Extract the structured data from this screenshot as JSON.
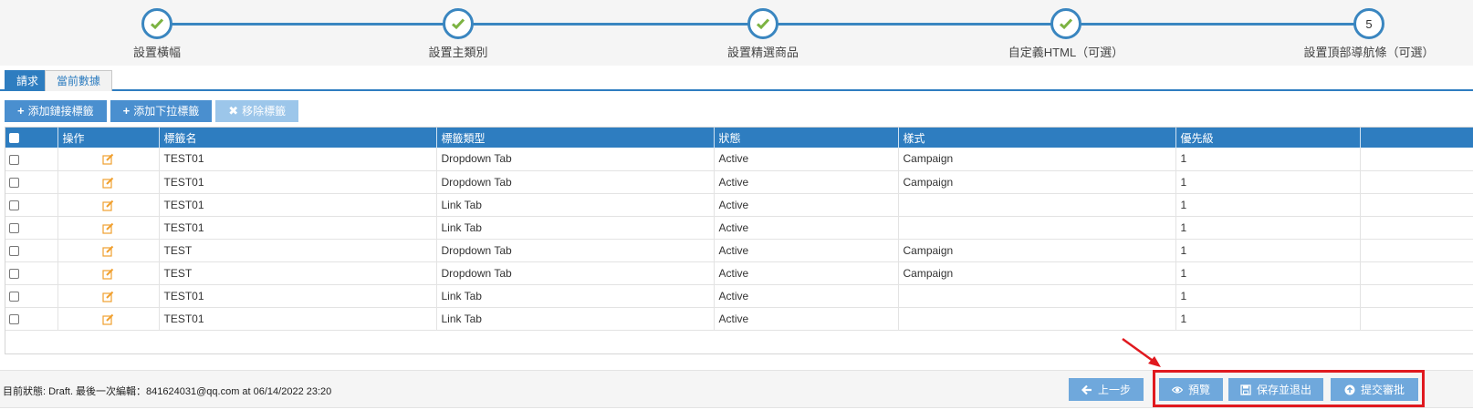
{
  "stepper": {
    "steps": [
      {
        "label": "設置橫幅",
        "done": true
      },
      {
        "label": "設置主類別",
        "done": true
      },
      {
        "label": "設置精選商品",
        "done": true
      },
      {
        "label": "自定義HTML（可選）",
        "done": true
      },
      {
        "label": "設置頂部導航條（可選）",
        "done": false,
        "number": "5"
      }
    ]
  },
  "tabs": [
    {
      "label": "請求",
      "active": true
    },
    {
      "label": "當前數據",
      "active": false
    }
  ],
  "toolbar": {
    "add_link_label": "添加鏈接標籤",
    "add_dropdown_label": "添加下拉標籤",
    "remove_label": "移除標籤"
  },
  "table": {
    "headers": [
      "",
      "操作",
      "標籤名",
      "標籤類型",
      "狀態",
      "樣式",
      "優先級",
      ""
    ],
    "rows": [
      {
        "name": "TEST01",
        "type": "Dropdown Tab",
        "status": "Active",
        "style": "Campaign",
        "priority": "1"
      },
      {
        "name": "TEST01",
        "type": "Dropdown Tab",
        "status": "Active",
        "style": "Campaign",
        "priority": "1"
      },
      {
        "name": "TEST01",
        "type": "Link Tab",
        "status": "Active",
        "style": "",
        "priority": "1"
      },
      {
        "name": "TEST01",
        "type": "Link Tab",
        "status": "Active",
        "style": "",
        "priority": "1"
      },
      {
        "name": "TEST",
        "type": "Dropdown Tab",
        "status": "Active",
        "style": "Campaign",
        "priority": "1"
      },
      {
        "name": "TEST",
        "type": "Dropdown Tab",
        "status": "Active",
        "style": "Campaign",
        "priority": "1"
      },
      {
        "name": "TEST01",
        "type": "Link Tab",
        "status": "Active",
        "style": "",
        "priority": "1"
      },
      {
        "name": "TEST01",
        "type": "Link Tab",
        "status": "Active",
        "style": "",
        "priority": "1"
      }
    ]
  },
  "footer": {
    "status_text": "目前狀態: Draft. 最後一次編輯：841624031@qq.com at 06/14/2022 23:20",
    "prev_label": "上一步",
    "preview_label": "預覽",
    "save_exit_label": "保存並退出",
    "submit_label": "提交審批"
  },
  "colors": {
    "primary": "#2e7dc0",
    "check": "#7cb342",
    "edit": "#f0a030",
    "highlight": "#e0191f"
  },
  "icons": {
    "step_done": "check-icon",
    "edit": "edit-icon",
    "prev": "arrow-left-icon",
    "preview": "eye-icon",
    "save": "floppy-icon",
    "submit": "upload-circle-icon"
  }
}
